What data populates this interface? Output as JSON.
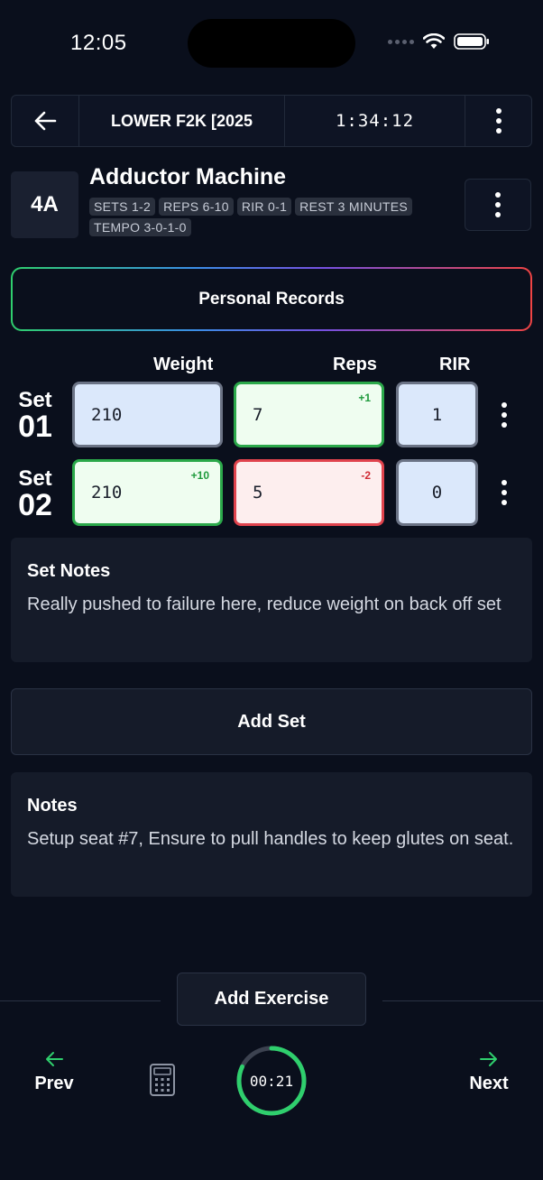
{
  "status_bar": {
    "time": "12:05"
  },
  "header": {
    "title": "LOWER F2K [2025",
    "elapsed": "1:34:12"
  },
  "exercise": {
    "code": "4A",
    "name": "Adductor Machine",
    "chips": [
      "SETS 1-2",
      "REPS 6-10",
      "RIR 0-1",
      "REST 3 MINUTES",
      "TEMPO 3-0-1-0"
    ]
  },
  "personal_records_label": "Personal Records",
  "columns": {
    "weight": "Weight",
    "reps": "Reps",
    "rir": "RIR"
  },
  "sets": [
    {
      "label_word": "Set",
      "label_num": "01",
      "weight": "210",
      "weight_delta": "",
      "reps": "7",
      "reps_delta": "+1",
      "rir": "1"
    },
    {
      "label_word": "Set",
      "label_num": "02",
      "weight": "210",
      "weight_delta": "+10",
      "reps": "5",
      "reps_delta": "-2",
      "rir": "0"
    }
  ],
  "set_notes": {
    "title": "Set Notes",
    "text": "Really pushed to failure here, reduce weight on back off set"
  },
  "add_set_label": "Add Set",
  "notes": {
    "title": "Notes",
    "text": "Setup seat #7, Ensure to pull handles to keep glutes on seat."
  },
  "add_exercise_label": "Add Exercise",
  "bottom_nav": {
    "prev": "Prev",
    "next": "Next",
    "rest_timer": "00:21",
    "rest_progress": 0.82
  },
  "colors": {
    "background": "#0a0f1c",
    "accent_green": "#2fcf6d",
    "increase": "#1f9a3c",
    "decrease": "#d02c36"
  },
  "icons": {
    "back": "arrow-left-icon",
    "menu": "vertical-dots-icon",
    "prev": "arrow-left-icon",
    "next": "arrow-right-icon",
    "calculator": "calculator-icon"
  }
}
